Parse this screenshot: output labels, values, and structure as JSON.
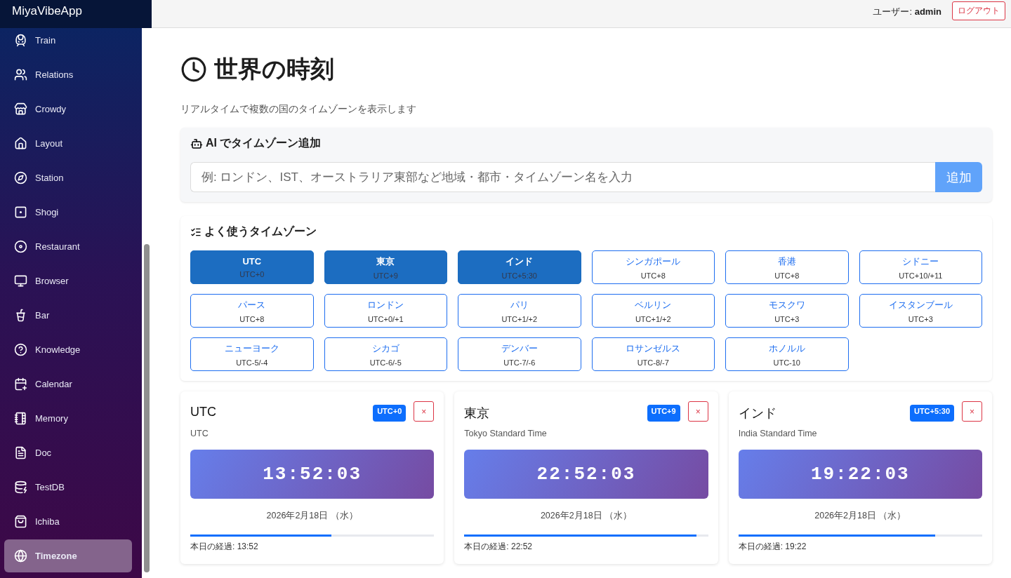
{
  "app_title": "MiyaVibeApp",
  "sidebar": {
    "items": [
      {
        "label": "Train",
        "selected": false
      },
      {
        "label": "Relations",
        "selected": false
      },
      {
        "label": "Crowdy",
        "selected": false
      },
      {
        "label": "Layout",
        "selected": false
      },
      {
        "label": "Station",
        "selected": false
      },
      {
        "label": "Shogi",
        "selected": false
      },
      {
        "label": "Restaurant",
        "selected": false
      },
      {
        "label": "Browser",
        "selected": false
      },
      {
        "label": "Bar",
        "selected": false
      },
      {
        "label": "Knowledge",
        "selected": false
      },
      {
        "label": "Calendar",
        "selected": false
      },
      {
        "label": "Memory",
        "selected": false
      },
      {
        "label": "Doc",
        "selected": false
      },
      {
        "label": "TestDB",
        "selected": false
      },
      {
        "label": "Ichiba",
        "selected": false
      },
      {
        "label": "Timezone",
        "selected": true
      }
    ]
  },
  "header": {
    "user_label": "ユーザー: ",
    "user_name": "admin",
    "logout": "ログアウト"
  },
  "page": {
    "title": "世界の時刻",
    "subtitle": "リアルタイムで複数の国のタイムゾーンを表示します"
  },
  "ai_add": {
    "title": "AI でタイムゾーン追加",
    "placeholder": "例: ロンドン、IST、オーストラリア東部など地域・都市・タイムゾーン名を入力",
    "button": "追加"
  },
  "presets": {
    "title": "よく使うタイムゾーン",
    "items": [
      {
        "name": "UTC",
        "offset": "UTC+0",
        "selected": true
      },
      {
        "name": "東京",
        "offset": "UTC+9",
        "selected": true
      },
      {
        "name": "インド",
        "offset": "UTC+5:30",
        "selected": true
      },
      {
        "name": "シンガポール",
        "offset": "UTC+8",
        "selected": false
      },
      {
        "name": "香港",
        "offset": "UTC+8",
        "selected": false
      },
      {
        "name": "シドニー",
        "offset": "UTC+10/+11",
        "selected": false
      },
      {
        "name": "パース",
        "offset": "UTC+8",
        "selected": false
      },
      {
        "name": "ロンドン",
        "offset": "UTC+0/+1",
        "selected": false
      },
      {
        "name": "パリ",
        "offset": "UTC+1/+2",
        "selected": false
      },
      {
        "name": "ベルリン",
        "offset": "UTC+1/+2",
        "selected": false
      },
      {
        "name": "モスクワ",
        "offset": "UTC+3",
        "selected": false
      },
      {
        "name": "イスタンブール",
        "offset": "UTC+3",
        "selected": false
      },
      {
        "name": "ニューヨーク",
        "offset": "UTC-5/-4",
        "selected": false
      },
      {
        "name": "シカゴ",
        "offset": "UTC-6/-5",
        "selected": false
      },
      {
        "name": "デンバー",
        "offset": "UTC-7/-6",
        "selected": false
      },
      {
        "name": "ロサンゼルス",
        "offset": "UTC-8/-7",
        "selected": false
      },
      {
        "name": "ホノルル",
        "offset": "UTC-10",
        "selected": false
      }
    ]
  },
  "clocks": [
    {
      "name": "UTC",
      "zone": "UTC",
      "badge": "UTC+0",
      "remove": "×",
      "time": "13:52:03",
      "date": "2026年2月18日 （水）",
      "progress_label": "本日の経過: 13:52",
      "level": 0.578
    },
    {
      "name": "東京",
      "zone": "Tokyo Standard Time",
      "badge": "UTC+9",
      "remove": "×",
      "time": "22:52:03",
      "date": "2026年2月18日 （水）",
      "progress_label": "本日の経過: 22:52",
      "level": 0.953
    },
    {
      "name": "インド",
      "zone": "India Standard Time",
      "badge": "UTC+5:30",
      "remove": "×",
      "time": "19:22:03",
      "date": "2026年2月18日 （水）",
      "progress_label": "本日の経過: 19:22",
      "level": 0.807
    }
  ]
}
